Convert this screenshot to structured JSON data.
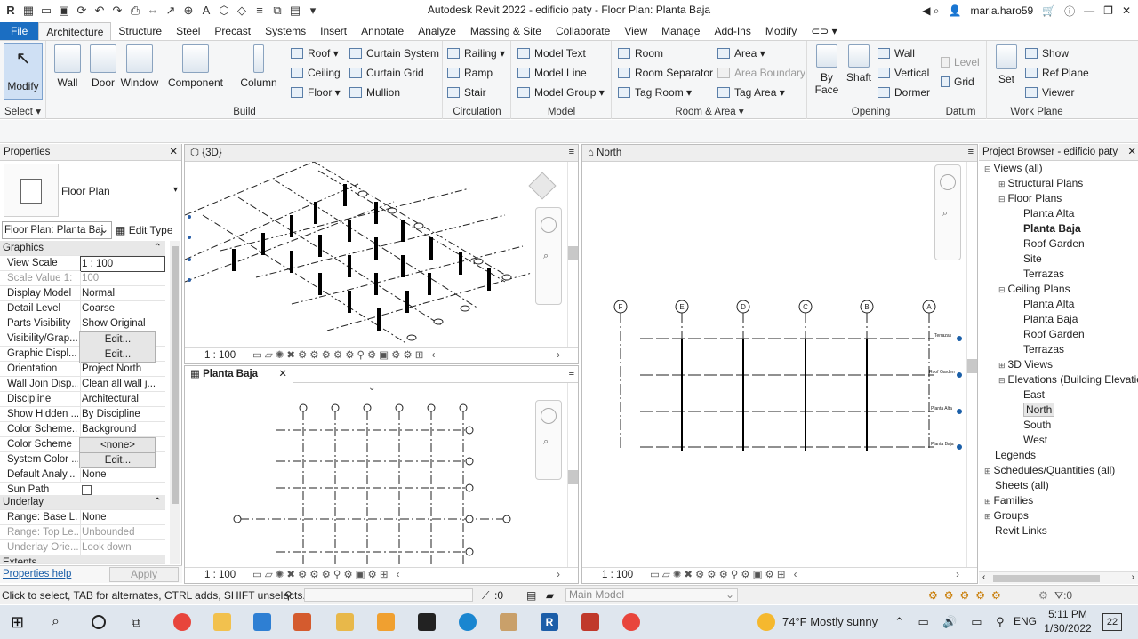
{
  "window": {
    "title": "Autodesk Revit 2022 - edificio paty - Floor Plan: Planta Baja",
    "user": "maria.haro59"
  },
  "tabs": [
    "File",
    "Architecture",
    "Structure",
    "Steel",
    "Precast",
    "Systems",
    "Insert",
    "Annotate",
    "Analyze",
    "Massing & Site",
    "Collaborate",
    "View",
    "Manage",
    "Add-Ins",
    "Modify"
  ],
  "ribbon": {
    "select": {
      "modify": "Modify",
      "panel": "Select"
    },
    "build": {
      "wall": "Wall",
      "door": "Door",
      "window": "Window",
      "component": "Component",
      "column": "Column",
      "roof": "Roof",
      "ceiling": "Ceiling",
      "floor": "Floor",
      "curtain_system": "Curtain System",
      "curtain_grid": "Curtain Grid",
      "mullion": "Mullion",
      "panel": "Build"
    },
    "circulation": {
      "railing": "Railing",
      "ramp": "Ramp",
      "stair": "Stair",
      "panel": "Circulation"
    },
    "model": {
      "model_text": "Model Text",
      "model_line": "Model Line",
      "model_group": "Model Group",
      "panel": "Model"
    },
    "room": {
      "room": "Room",
      "room_separator": "Room Separator",
      "tag_room": "Tag Room",
      "area": "Area",
      "area_boundary": "Area Boundary",
      "tag_area": "Tag Area",
      "panel": "Room & Area"
    },
    "opening": {
      "by_face": "By Face",
      "by_face2": "Face",
      "shaft": "Shaft",
      "wall": "Wall",
      "vertical": "Vertical",
      "dormer": "Dormer",
      "panel": "Opening"
    },
    "datum": {
      "level": "Level",
      "grid": "Grid",
      "panel": "Datum"
    },
    "workplane": {
      "set": "Set",
      "show": "Show",
      "ref_plane": "Ref Plane",
      "viewer": "Viewer",
      "panel": "Work Plane"
    }
  },
  "properties": {
    "title": "Properties",
    "type": "Floor Plan",
    "selector": "Floor Plan: Planta Baj",
    "edit_type": "Edit Type",
    "groups": {
      "graphics": "Graphics",
      "underlay": "Underlay",
      "extents": "Extents"
    },
    "rows": [
      {
        "k": "View Scale",
        "v": "1 : 100"
      },
      {
        "k": "Scale Value    1:",
        "v": "100"
      },
      {
        "k": "Display Model",
        "v": "Normal"
      },
      {
        "k": "Detail Level",
        "v": "Coarse"
      },
      {
        "k": "Parts Visibility",
        "v": "Show Original"
      },
      {
        "k": "Visibility/Grap...",
        "v": "Edit..."
      },
      {
        "k": "Graphic Displ...",
        "v": "Edit..."
      },
      {
        "k": "Orientation",
        "v": "Project North"
      },
      {
        "k": "Wall Join Disp...",
        "v": "Clean all wall j..."
      },
      {
        "k": "Discipline",
        "v": "Architectural"
      },
      {
        "k": "Show Hidden ...",
        "v": "By Discipline"
      },
      {
        "k": "Color Scheme...",
        "v": "Background"
      },
      {
        "k": "Color Scheme",
        "v": "<none>"
      },
      {
        "k": "System Color ...",
        "v": "Edit..."
      },
      {
        "k": "Default Analy...",
        "v": "None"
      },
      {
        "k": "Sun Path",
        "v": ""
      }
    ],
    "underlay_rows": [
      {
        "k": "Range: Base L...",
        "v": "None"
      },
      {
        "k": "Range: Top Le...",
        "v": "Unbounded"
      },
      {
        "k": "Underlay Orie...",
        "v": "Look down"
      }
    ],
    "help": "Properties help",
    "apply": "Apply"
  },
  "views": {
    "v3d": {
      "tab": "{3D}",
      "scale": "1 : 100"
    },
    "planta": {
      "tab": "Planta Baja",
      "scale": "1 : 100"
    },
    "north": {
      "tab": "North",
      "scale": "1 : 100",
      "grids": [
        "F",
        "E",
        "D",
        "C",
        "B",
        "A"
      ],
      "levels": [
        "Terrazas",
        "Roof Garden",
        "Planta Alta",
        "Planta Baja"
      ]
    }
  },
  "browser": {
    "title": "Project Browser - edificio paty",
    "items": [
      {
        "label": "Views (all)"
      },
      {
        "label": "Structural Plans"
      },
      {
        "label": "Floor Plans"
      },
      {
        "label": "Planta Alta"
      },
      {
        "label": "Planta Baja"
      },
      {
        "label": "Roof Garden"
      },
      {
        "label": "Site"
      },
      {
        "label": "Terrazas"
      },
      {
        "label": "Ceiling Plans"
      },
      {
        "label": "Planta Alta"
      },
      {
        "label": "Planta Baja"
      },
      {
        "label": "Roof Garden"
      },
      {
        "label": "Terrazas"
      },
      {
        "label": "3D Views"
      },
      {
        "label": "Elevations (Building Elevation)"
      },
      {
        "label": "East"
      },
      {
        "label": "North"
      },
      {
        "label": "South"
      },
      {
        "label": "West"
      },
      {
        "label": "Legends"
      },
      {
        "label": "Schedules/Quantities (all)"
      },
      {
        "label": "Sheets (all)"
      },
      {
        "label": "Families"
      },
      {
        "label": "Groups"
      },
      {
        "label": "Revit Links"
      }
    ]
  },
  "status": {
    "hint": "Click to select, TAB for alternates, CTRL adds, SHIFT unselects.",
    "sel_count": ":0",
    "model": "Main Model",
    "filter": ":0"
  },
  "taskbar": {
    "weather": "74°F  Mostly sunny",
    "lang": "ENG",
    "time": "5:11 PM",
    "date": "1/30/2022",
    "notif": "22"
  }
}
